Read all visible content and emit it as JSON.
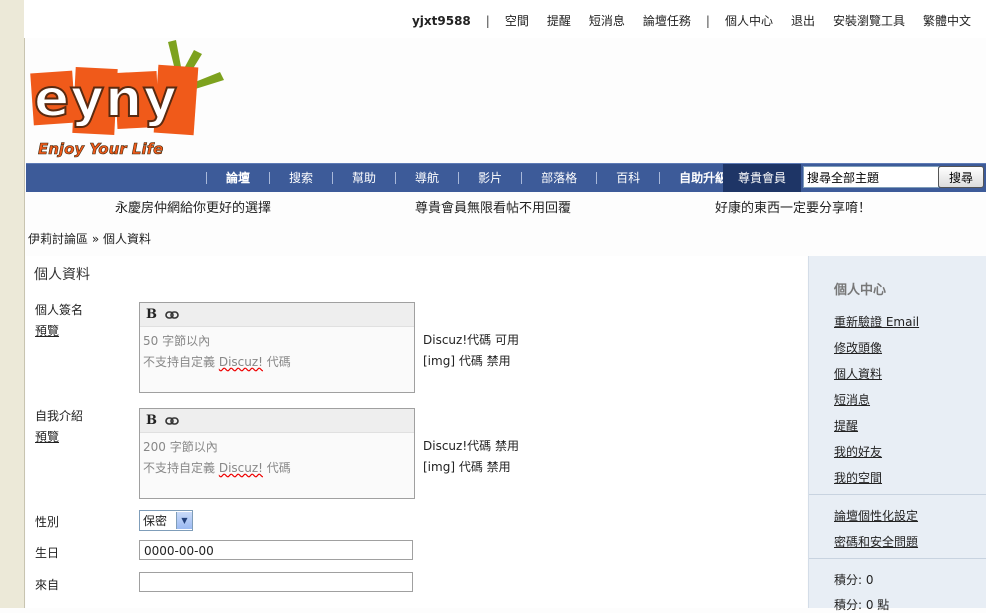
{
  "topbar": {
    "username": "yjxt9588",
    "links": [
      "空間",
      "提醒",
      "短消息",
      "論壇任務"
    ],
    "links2": [
      "個人中心",
      "退出",
      "安裝瀏覽工具",
      "繁體中文"
    ]
  },
  "logo": {
    "brand": "eyny",
    "tagline": "Enjoy Your Life"
  },
  "nav": {
    "items": [
      "論壇",
      "搜索",
      "幫助",
      "導航",
      "影片",
      "部落格",
      "百科",
      "自助升級"
    ],
    "vip": "尊貴會員",
    "search_value": "搜尋全部主題",
    "search_button": "搜尋"
  },
  "ads": [
    "永慶房仲網給你更好的選擇",
    "尊貴會員無限看帖不用回覆",
    "好康的東西一定要分享唷！"
  ],
  "breadcrumb": {
    "root": "伊莉討論區",
    "sep": "»",
    "current": "個人資料"
  },
  "form": {
    "title": "個人資料",
    "signature": {
      "label": "個人簽名",
      "preview": "預覽",
      "placeholder_line1": "50 字節以內",
      "placeholder_line2_pre": "不支持自定義 ",
      "placeholder_line2_word": "Discuz!",
      "placeholder_line2_post": " 代碼",
      "note1": "Discuz!代碼 可用",
      "note2": "[img] 代碼 禁用"
    },
    "intro": {
      "label": "自我介紹",
      "preview": "預覽",
      "placeholder_line1": "200 字節以內",
      "placeholder_line2_pre": "不支持自定義 ",
      "placeholder_line2_word": "Discuz!",
      "placeholder_line2_post": " 代碼",
      "note1": "Discuz!代碼 禁用",
      "note2": "[img] 代碼 禁用"
    },
    "gender": {
      "label": "性別",
      "value": "保密"
    },
    "birthday": {
      "label": "生日",
      "value": "0000-00-00"
    },
    "from": {
      "label": "來自",
      "value": ""
    },
    "bold_icon": "B"
  },
  "sidebar": {
    "title": "個人中心",
    "links": [
      "重新驗證 Email",
      "修改頭像",
      "個人資料",
      "短消息",
      "提醒",
      "我的好友",
      "我的空間"
    ],
    "links2": [
      "論壇個性化設定",
      "密碼和安全問題"
    ],
    "stat1": "積分: 0",
    "stat2": "積分: 0 點"
  },
  "colors": {
    "nav": "#3d5b99",
    "vip": "#1e3566",
    "logo_orange": "#f05a1a",
    "logo_green": "#7da21e"
  }
}
